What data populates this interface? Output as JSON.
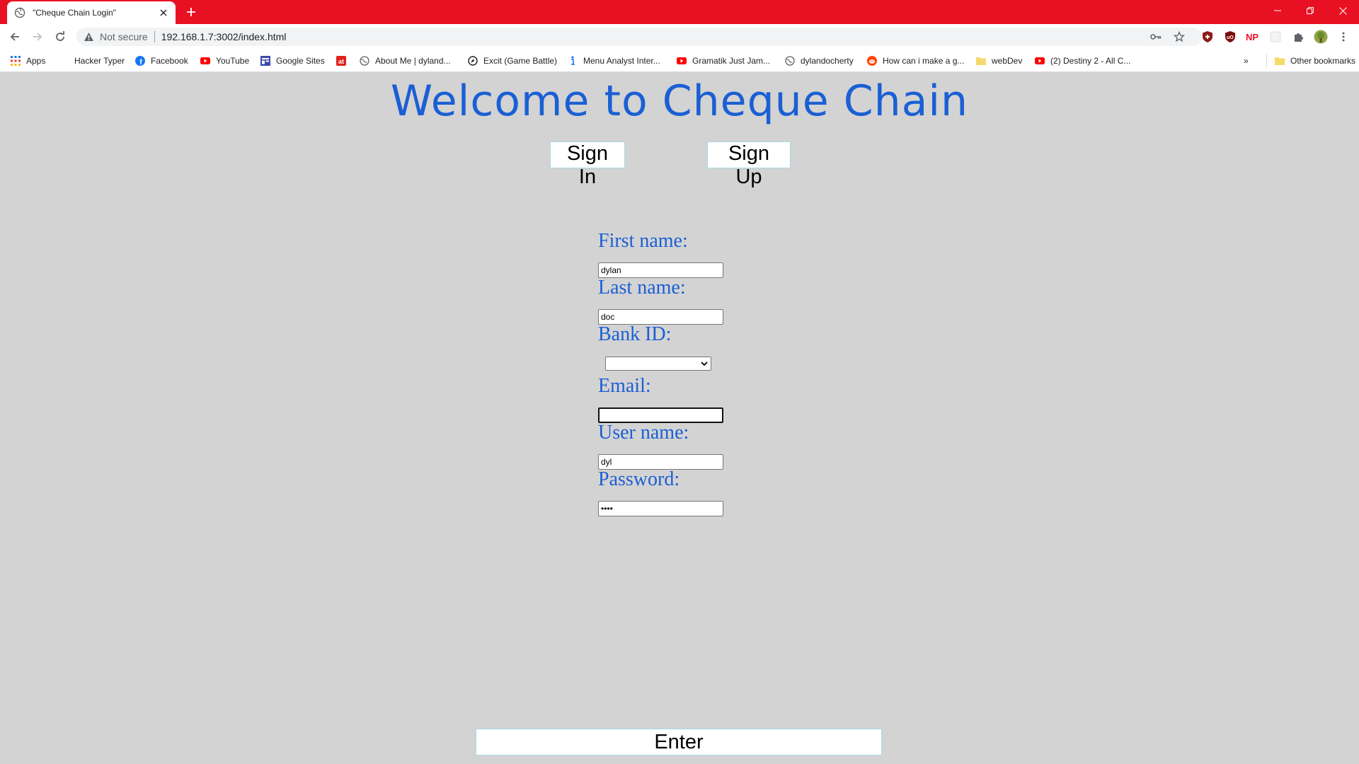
{
  "browser": {
    "tab_title": "\"Cheque Chain Login\"",
    "security_label": "Not secure",
    "url": "192.168.1.7:3002/index.html",
    "theme_color": "#e81123"
  },
  "bookmarks": {
    "apps": "Apps",
    "items": [
      {
        "label": "Hacker Typer",
        "icon": "blank-icon"
      },
      {
        "label": "Facebook",
        "icon": "facebook-icon"
      },
      {
        "label": "YouTube",
        "icon": "youtube-icon"
      },
      {
        "label": "Google Sites",
        "icon": "google-sites-icon"
      },
      {
        "label": "",
        "icon": "at-icon"
      },
      {
        "label": "About Me | dyland...",
        "icon": "globe-icon"
      },
      {
        "label": "Excit (Game Battle)",
        "icon": "compass-icon"
      },
      {
        "label": "Menu Analyst Inter...",
        "icon": "info-icon"
      },
      {
        "label": "Gramatik Just Jam...",
        "icon": "youtube-icon"
      },
      {
        "label": "dylandocherty",
        "icon": "globe-icon"
      },
      {
        "label": "How can i make a g...",
        "icon": "reddit-icon"
      },
      {
        "label": "webDev",
        "icon": "folder-icon"
      },
      {
        "label": "(2) Destiny 2 - All C...",
        "icon": "youtube-icon"
      }
    ],
    "overflow": "»",
    "other": "Other bookmarks"
  },
  "page": {
    "heading": "Welcome to Cheque Chain",
    "heading_color": "#1a5fd4",
    "sign_in": "Sign In",
    "sign_up": "Sign Up",
    "form": {
      "first_name_label": "First name:",
      "first_name_value": "dylan",
      "last_name_label": "Last name:",
      "last_name_value": "doc",
      "bank_id_label": "Bank ID:",
      "bank_id_value": "",
      "email_label": "Email:",
      "email_value": "",
      "user_name_label": "User name:",
      "user_name_value": "dyl",
      "password_label": "Password:",
      "password_value": "••••"
    },
    "enter": "Enter"
  }
}
